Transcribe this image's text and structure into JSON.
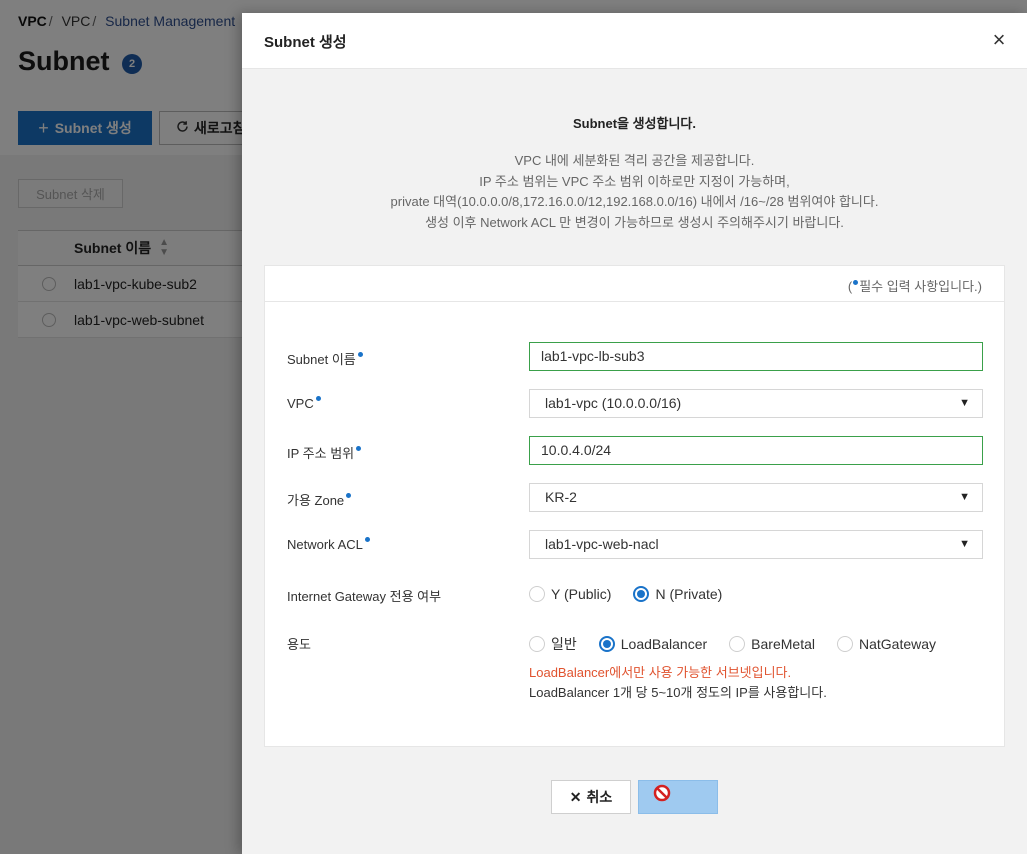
{
  "breadcrumb": {
    "root": "VPC",
    "middle": "VPC",
    "current": "Subnet Management"
  },
  "page": {
    "title": "Subnet",
    "count": "2",
    "create_label": "Subnet 생성",
    "refresh_label": "새로고침",
    "delete_label": "Subnet 삭제"
  },
  "subnet_list": {
    "column_header": "Subnet 이름",
    "rows": [
      "lab1-vpc-kube-sub2",
      "lab1-vpc-web-subnet"
    ]
  },
  "modal": {
    "title": "Subnet 생성",
    "intro_title": "Subnet을 생성합니다.",
    "intro_lines": [
      "VPC 내에 세분화된 격리 공간을 제공합니다.",
      "IP 주소 범위는 VPC 주소 범위 이하로만 지정이 가능하며,",
      "private 대역(10.0.0.0/8,172.16.0.0/12,192.168.0.0/16) 내에서 /16~/28 범위여야 합니다.",
      "생성 이후 Network ACL 만 변경이 가능하므로 생성시 주의해주시기 바랍니다."
    ],
    "required_note_prefix": "(",
    "required_note_suffix": "필수 입력 사항입니다.)",
    "fields": {
      "subnet_name": {
        "label": "Subnet 이름",
        "value": "lab1-vpc-lb-sub3"
      },
      "vpc": {
        "label": "VPC",
        "value": "lab1-vpc (10.0.0.0/16)"
      },
      "ip_range": {
        "label": "IP 주소 범위",
        "value": "10.0.4.0/24"
      },
      "zone": {
        "label": "가용 Zone",
        "value": "KR-2"
      },
      "network_acl": {
        "label": "Network ACL",
        "value": "lab1-vpc-web-nacl"
      },
      "igw": {
        "label": "Internet Gateway 전용 여부",
        "options": [
          "Y (Public)",
          "N (Private)"
        ],
        "selected": "N (Private)"
      },
      "usage": {
        "label": "용도",
        "options": [
          "일반",
          "LoadBalancer",
          "BareMetal",
          "NatGateway"
        ],
        "selected": "LoadBalancer",
        "warning": "LoadBalancer에서만 사용 가능한 서브넷입니다.",
        "info": "LoadBalancer 1개 당 5~10개 정도의 IP를 사용합니다."
      }
    },
    "cancel_label": "취소"
  },
  "colors": {
    "primary": "#1a73c9",
    "input_border_valid": "#3aa04a",
    "warning": "#e0532f",
    "confirm_disabled": "#9fcaf0"
  }
}
